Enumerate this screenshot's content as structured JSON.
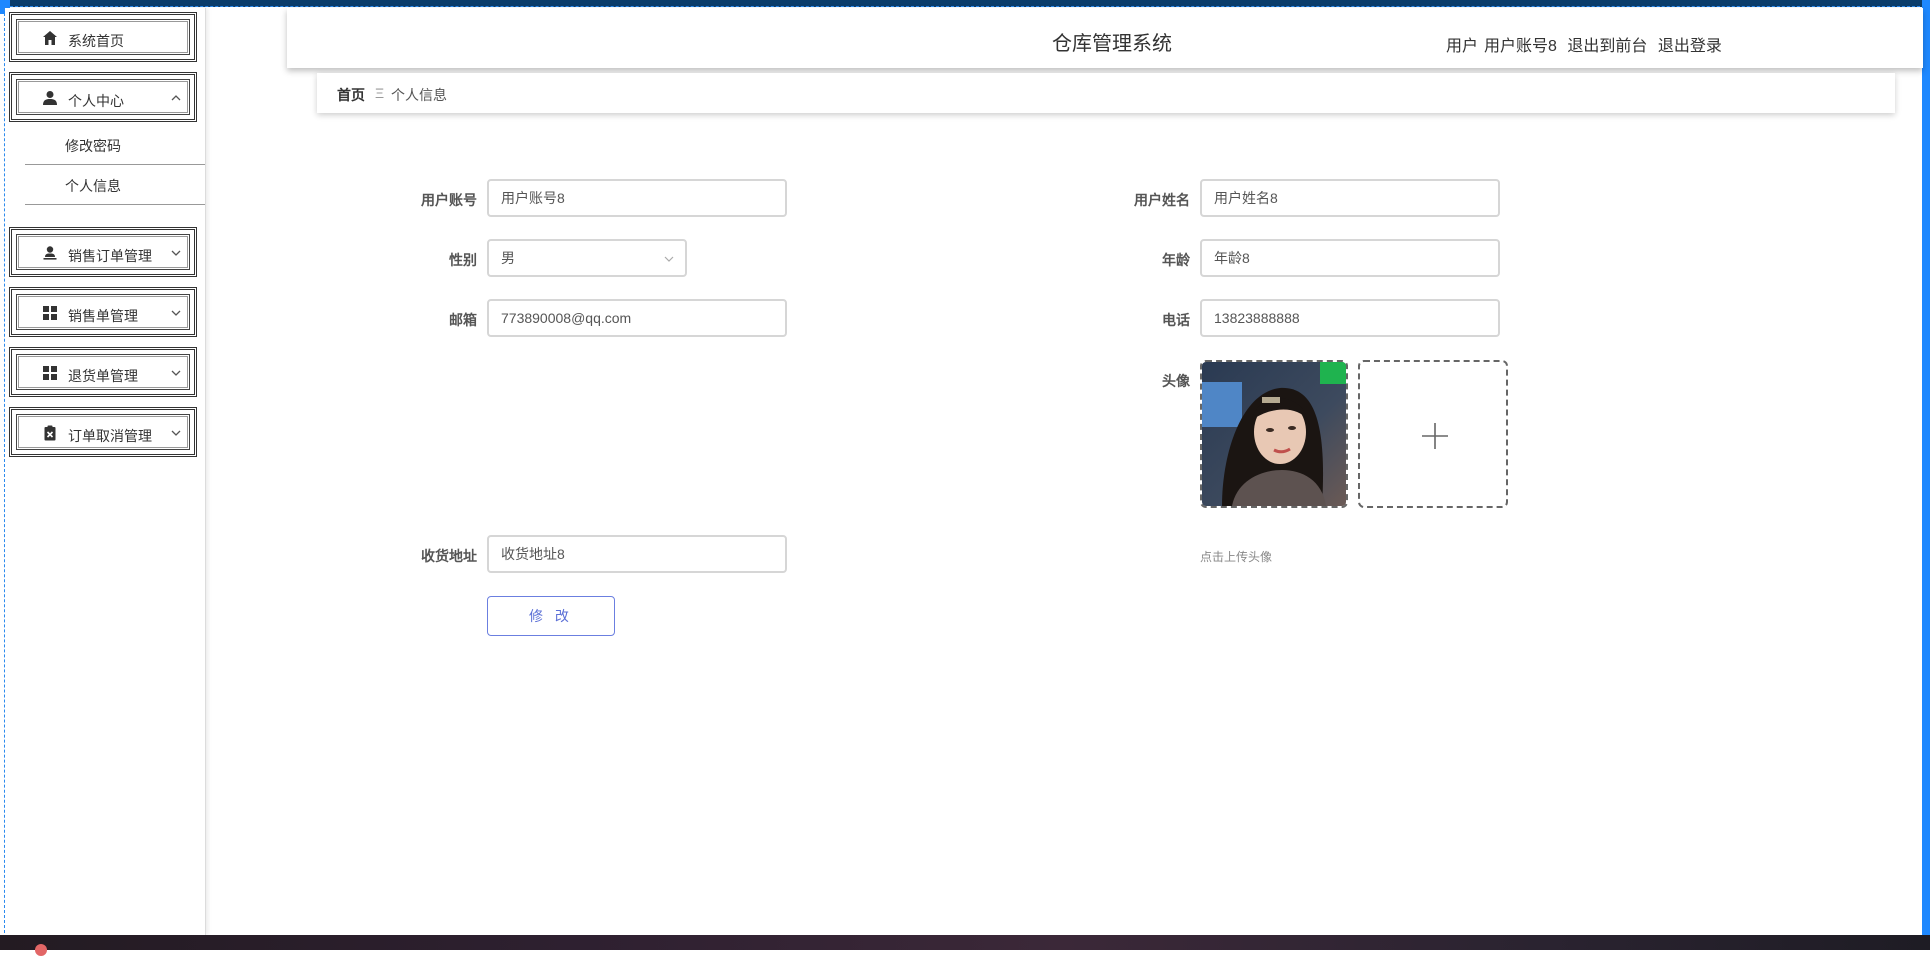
{
  "app": {
    "title": "仓库管理系统"
  },
  "header": {
    "user_prefix": "用户",
    "username": "用户账号8",
    "front_link": "退出到前台",
    "logout_link": "退出登录"
  },
  "sidebar": {
    "home": "系统首页",
    "personal_center": "个人中心",
    "sub_change_password": "修改密码",
    "sub_personal_info": "个人信息",
    "sales_order_mgmt": "销售订单管理",
    "sales_mgmt": "销售单管理",
    "return_mgmt": "退货单管理",
    "cancel_mgmt": "订单取消管理"
  },
  "breadcrumb": {
    "home": "首页",
    "separator": "Ξ",
    "current": "个人信息"
  },
  "form": {
    "account_label": "用户账号",
    "account_value": "用户账号8",
    "name_label": "用户姓名",
    "name_value": "用户姓名8",
    "gender_label": "性别",
    "gender_value": "男",
    "age_label": "年龄",
    "age_value": "年龄8",
    "email_label": "邮箱",
    "email_value": "773890008@qq.com",
    "phone_label": "电话",
    "phone_value": "13823888888",
    "avatar_label": "头像",
    "upload_hint": "点击上传头像",
    "address_label": "收货地址",
    "address_value": "收货地址8",
    "submit_label": "修 改"
  },
  "colors": {
    "accent": "#5b6fd6",
    "border": "#d6d6d6",
    "brand_blue": "#1e88ff"
  }
}
